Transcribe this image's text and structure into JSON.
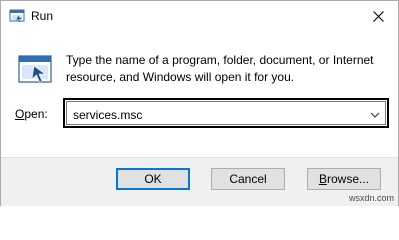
{
  "window": {
    "title": "Run",
    "icon": "run-icon",
    "close_icon": "close-icon"
  },
  "content": {
    "description_line1": "Type the name of a program, folder, document, or Internet",
    "description_line2": "resource, and Windows will open it for you.",
    "open_label_accel": "O",
    "open_label_rest": "pen:",
    "open_value": "services.msc"
  },
  "buttons": {
    "ok": "OK",
    "cancel": "Cancel",
    "browse_accel": "B",
    "browse_rest": "rowse..."
  },
  "watermark": "wsxdn.com",
  "colors": {
    "accent": "#0078d7",
    "footer_bg": "#f0f0f0",
    "button_bg": "#e1e1e1"
  }
}
